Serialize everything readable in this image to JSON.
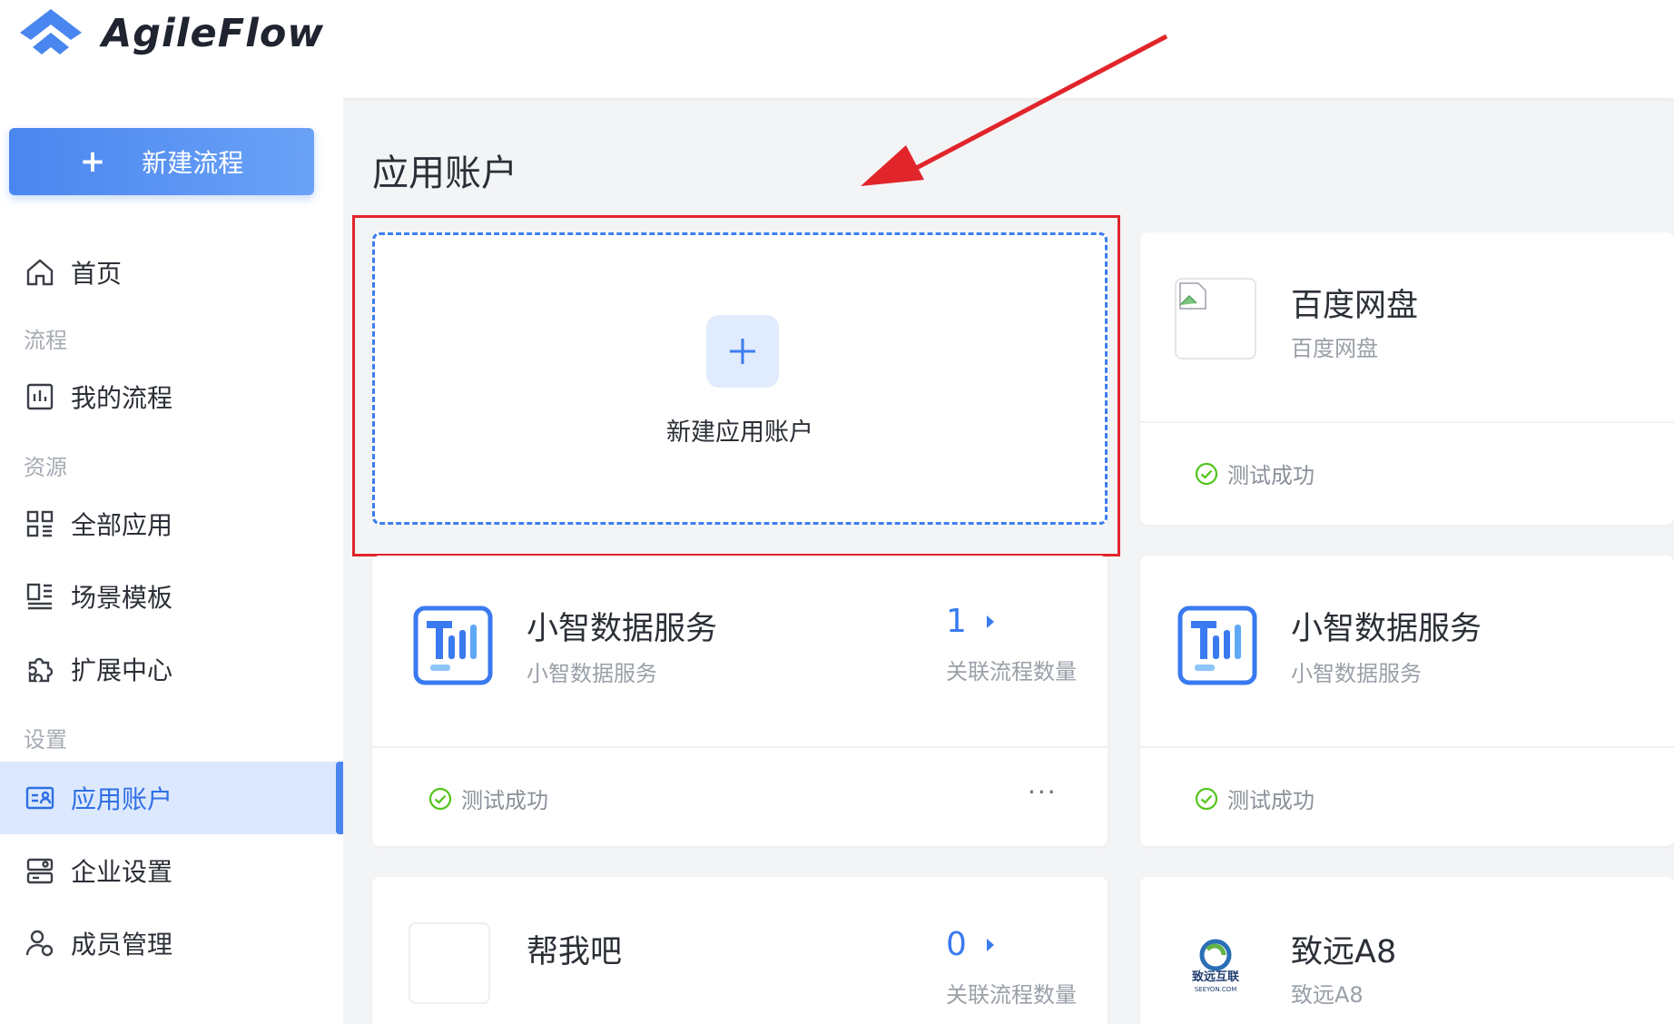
{
  "header": {
    "brand": "AgileFlow"
  },
  "sidebar": {
    "new_flow_label": "新建流程",
    "items": [
      {
        "label": "首页",
        "icon": "home-icon"
      },
      {
        "section": "流程"
      },
      {
        "label": "我的流程",
        "icon": "flow-chart-icon"
      },
      {
        "section": "资源"
      },
      {
        "label": "全部应用",
        "icon": "grid-icon"
      },
      {
        "label": "场景模板",
        "icon": "template-icon"
      },
      {
        "label": "扩展中心",
        "icon": "puzzle-icon"
      },
      {
        "section": "设置"
      },
      {
        "label": "应用账户",
        "icon": "account-card-icon",
        "active": true
      },
      {
        "label": "企业设置",
        "icon": "enterprise-icon"
      },
      {
        "label": "成员管理",
        "icon": "members-icon"
      }
    ]
  },
  "main": {
    "title": "应用账户",
    "new_account_label": "新建应用账户",
    "cards": [
      {
        "name": "百度网盘",
        "sub": "百度网盘",
        "status": "测试成功"
      },
      {
        "name": "小智数据服务",
        "sub": "小智数据服务",
        "count": "1",
        "count_label": "关联流程数量",
        "status": "测试成功",
        "more": "···"
      },
      {
        "name": "小智数据服务",
        "sub": "小智数据服务",
        "status": "测试成功"
      },
      {
        "name": "帮我吧",
        "count": "0",
        "count_label": "关联流程数量"
      },
      {
        "name": "致远A8",
        "sub": "致远A8",
        "logo_text": "致远互联",
        "logo_sub": "SEEYON.COM"
      }
    ]
  },
  "colors": {
    "accent": "#4a86ef",
    "success": "#52c41a",
    "highlight": "#e1252b"
  }
}
